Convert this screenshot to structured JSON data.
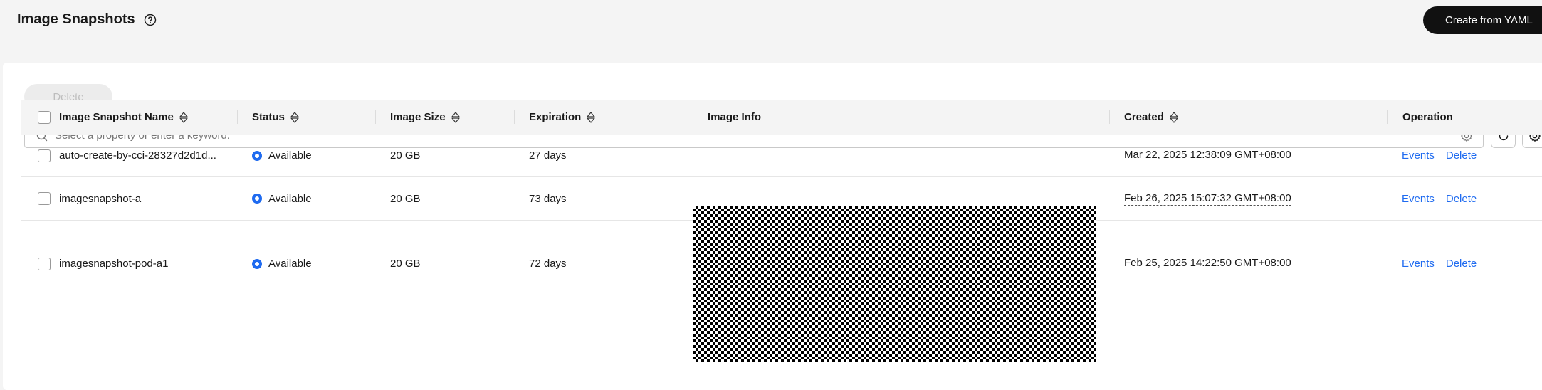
{
  "header": {
    "title": "Image Snapshots",
    "create_label": "Create from YAML"
  },
  "toolbar": {
    "delete_label": "Delete"
  },
  "search": {
    "placeholder": "Select a property or enter a keyword."
  },
  "table": {
    "columns": [
      "Image Snapshot Name",
      "Status",
      "Image Size",
      "Expiration",
      "Image Info",
      "Created",
      "Operation"
    ],
    "rows": [
      {
        "name": "auto-create-by-cci-28327d2d1d...",
        "status": "Available",
        "size": "20 GB",
        "expiration": "27 days",
        "created": "Mar 22, 2025 12:38:09 GMT+08:00",
        "ops": [
          "Events",
          "Delete"
        ]
      },
      {
        "name": "imagesnapshot-a",
        "status": "Available",
        "size": "20 GB",
        "expiration": "73 days",
        "created": "Feb 26, 2025 15:07:32 GMT+08:00",
        "ops": [
          "Events",
          "Delete"
        ]
      },
      {
        "name": "imagesnapshot-pod-a1",
        "status": "Available",
        "size": "20 GB",
        "expiration": "72 days",
        "created": "Feb 25, 2025 14:22:50 GMT+08:00",
        "ops": [
          "Events",
          "Delete"
        ]
      }
    ]
  },
  "colors": {
    "accent": "#1f6bf0",
    "primary_button": "#111111",
    "page_background": "#f4f4f4"
  },
  "icons": [
    "help-icon",
    "search-icon",
    "settings-icon",
    "refresh-icon",
    "gear-icon",
    "sort-icon",
    "status-available-icon"
  ]
}
